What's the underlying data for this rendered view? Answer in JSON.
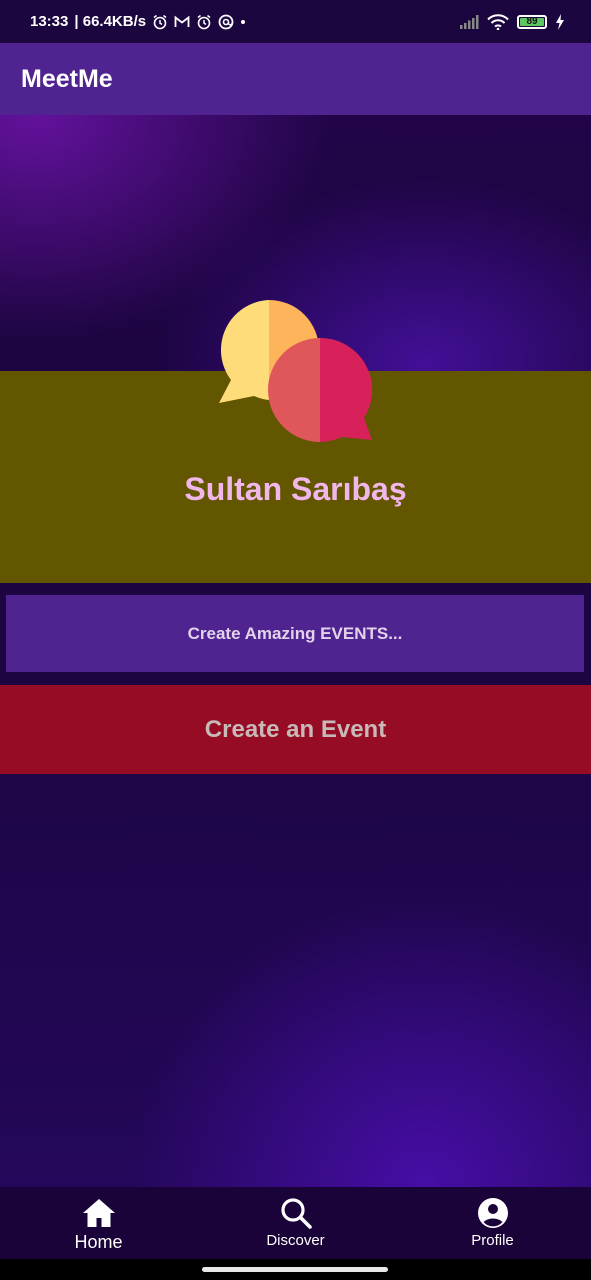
{
  "status_bar": {
    "time": "13:33",
    "speed": "| 66.4KB/s",
    "icons": [
      "alarm-icon",
      "gmail-icon",
      "alarm-icon",
      "at-icon",
      "dot"
    ],
    "battery": "89"
  },
  "app_bar": {
    "title": "MeetMe"
  },
  "hero": {
    "logo_icon": "chat-bubbles-icon",
    "user_name": "Sultan Sarıbaş"
  },
  "tagline": "Create Amazing EVENTS...",
  "create_button": {
    "label": "Create an Event",
    "color": "#970c25"
  },
  "bottom_nav": {
    "items": [
      {
        "label": "Home",
        "icon": "home-icon",
        "active": true
      },
      {
        "label": "Discover",
        "icon": "search-icon",
        "active": false
      },
      {
        "label": "Profile",
        "icon": "account-circle-icon",
        "active": false
      }
    ]
  },
  "colors": {
    "app_bar": "#502490",
    "olive_band": "#625600",
    "name_text": "#f1b6ea",
    "background": "#1a0438"
  }
}
